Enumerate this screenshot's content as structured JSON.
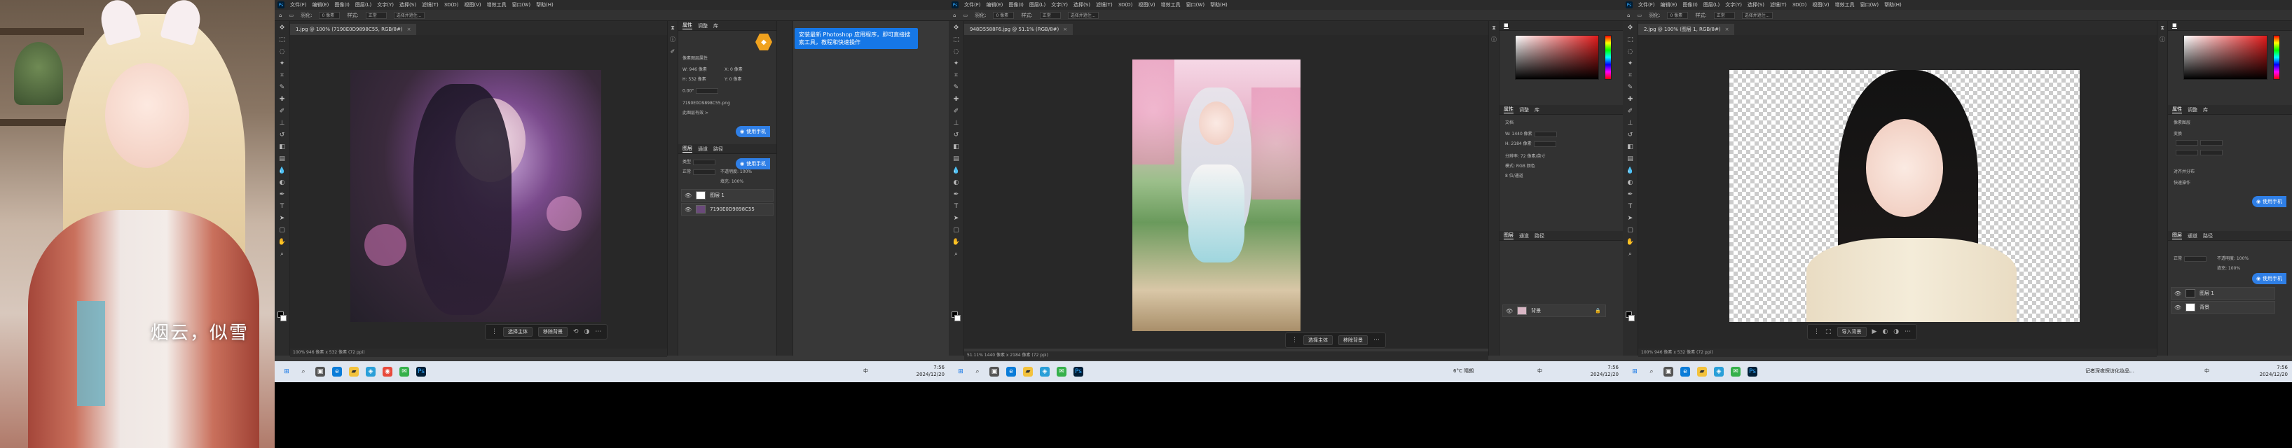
{
  "photo_panel": {
    "caption": "烟云，似雪"
  },
  "menu_items": [
    "文件(F)",
    "编辑(E)",
    "图像(I)",
    "图层(L)",
    "文字(Y)",
    "选择(S)",
    "滤镜(T)",
    "3D(D)",
    "视图(V)",
    "增效工具",
    "窗口(W)",
    "帮助(H)"
  ],
  "options": {
    "feather_label": "羽化:",
    "feather_value": "0 像素",
    "style_label": "样式:",
    "style_value": "正常",
    "select_mask": "选择并遮住..."
  },
  "monitors": [
    {
      "doc_tab": "1.jpg @ 100% (7190E0D9898C55, RGB/8#)",
      "status": "100%  946 像素 x 532 像素 (72 ppi)",
      "ctx_buttons": [
        "选择主体",
        "移除背景"
      ],
      "properties": {
        "tabs": [
          "属性",
          "调整",
          "库"
        ],
        "section": "像素图层属性",
        "w_label": "W: 946 像素",
        "h_label": "H: 532 像素",
        "x_label": "X: 0 像素",
        "y_label": "Y: 0 像素",
        "angle": "0.00°",
        "file": "7190E0D9898C55.png",
        "note": "此图层有效 >"
      },
      "layers": {
        "tabs": [
          "图层",
          "通道",
          "路径"
        ],
        "kind": "类型",
        "blend": "正常",
        "opacity": "不透明度: 100%",
        "fill": "填充: 100%",
        "rows": [
          "图层 1",
          "7190E0D9898C55"
        ]
      },
      "pills": [
        "使用手机",
        "使用手机"
      ],
      "tooltip": "安装最新 Photoshop 应用程序，即可直接搜索工具，教程和快速操作"
    },
    {
      "doc_tab": "948D5588F6.jpg @ 51.1% (RGB/8#)",
      "status": "51.11%  1440 像素 x 2184 像素 (72 ppi)",
      "ctx_buttons": [
        "选择主体",
        "移除背景"
      ],
      "properties": {
        "tabs": [
          "属性",
          "调整",
          "库"
        ],
        "section": "文档",
        "w_label": "W: 1440 像素",
        "h_label": "H: 2184 像素",
        "resolution": "分辨率: 72 像素/英寸",
        "mode": "模式: RGB 颜色",
        "depth": "8 位/通道"
      },
      "layers": {
        "tabs": [
          "图层",
          "通道",
          "路径"
        ],
        "rows": [
          "背景"
        ]
      }
    },
    {
      "doc_tab": "2.jpg @ 100% (图层 1, RGB/8#)",
      "status": "100%  946 像素 x 532 像素 (72 ppi)",
      "ctx_buttons": [
        "导入背景"
      ],
      "properties": {
        "tabs": [
          "属性",
          "调整",
          "库"
        ],
        "section": "像素图层",
        "transform": "变换",
        "align": "对齐并分布",
        "quick": "快速操作"
      },
      "layers": {
        "tabs": [
          "图层",
          "通道",
          "路径"
        ],
        "blend": "正常",
        "opacity": "不透明度: 100%",
        "fill": "填充: 100%",
        "rows": [
          "图层 1",
          "背景"
        ]
      },
      "pills": [
        "使用手机",
        "使用手机"
      ]
    }
  ],
  "taskbars": [
    {
      "time": "7:56",
      "date": "2024/12/20",
      "lang": "中"
    },
    {
      "weather": "6°C 晴朗",
      "time": "7:56",
      "date": "2024/12/20",
      "lang": "中"
    },
    {
      "news": "记者深夜探访化妆品…",
      "time": "7:56",
      "date": "2024/12/20",
      "lang": "中"
    }
  ],
  "colors": {
    "ps_dark": "#383838",
    "accent_blue": "#2f7fe6",
    "badge_orange": "#f0a21e",
    "taskbar": "#dfe6f0"
  }
}
